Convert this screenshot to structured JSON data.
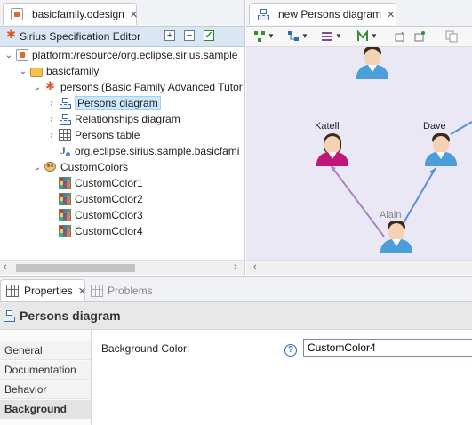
{
  "editor": {
    "tab_title": "basicfamily.odesign",
    "header_title": "Sirius Specification Editor",
    "tree": [
      {
        "label": "platform:/resource/org.eclipse.sirius.sample",
        "icon": "resource-icon"
      },
      {
        "label": "basicfamily",
        "icon": "folder-icon"
      },
      {
        "label": "persons (Basic Family Advanced Tutor",
        "icon": "viewpoint-icon"
      },
      {
        "label": "Persons diagram",
        "icon": "diagram-icon",
        "selected": true
      },
      {
        "label": "Relationships diagram",
        "icon": "diagram-icon"
      },
      {
        "label": "Persons table",
        "icon": "table-icon"
      },
      {
        "label": "org.eclipse.sirius.sample.basicfami",
        "icon": "java-icon"
      },
      {
        "label": "CustomColors",
        "icon": "palette-icon"
      },
      {
        "label": "CustomColor1",
        "icon": "color-icon"
      },
      {
        "label": "CustomColor2",
        "icon": "color-icon"
      },
      {
        "label": "CustomColor3",
        "icon": "color-icon"
      },
      {
        "label": "CustomColor4",
        "icon": "color-icon"
      }
    ]
  },
  "diagram": {
    "tab_title": "new Persons diagram",
    "nodes": [
      {
        "label": "Katell"
      },
      {
        "label": "Dave"
      },
      {
        "label": "Alain"
      }
    ]
  },
  "properties": {
    "tab_title": "Properties",
    "problems_tab": "Problems",
    "title": "Persons diagram",
    "sections": [
      "General",
      "Documentation",
      "Behavior",
      "Background"
    ],
    "active_section": "Background",
    "field_label": "Background Color:",
    "field_value": "CustomColor4"
  },
  "colors": {
    "canvas_bg": "#ebe8f5",
    "male_body": "#4b9ed9",
    "female_body": "#c0157a",
    "edge_female": "#a884c0",
    "edge_male": "#5a8fd1"
  }
}
